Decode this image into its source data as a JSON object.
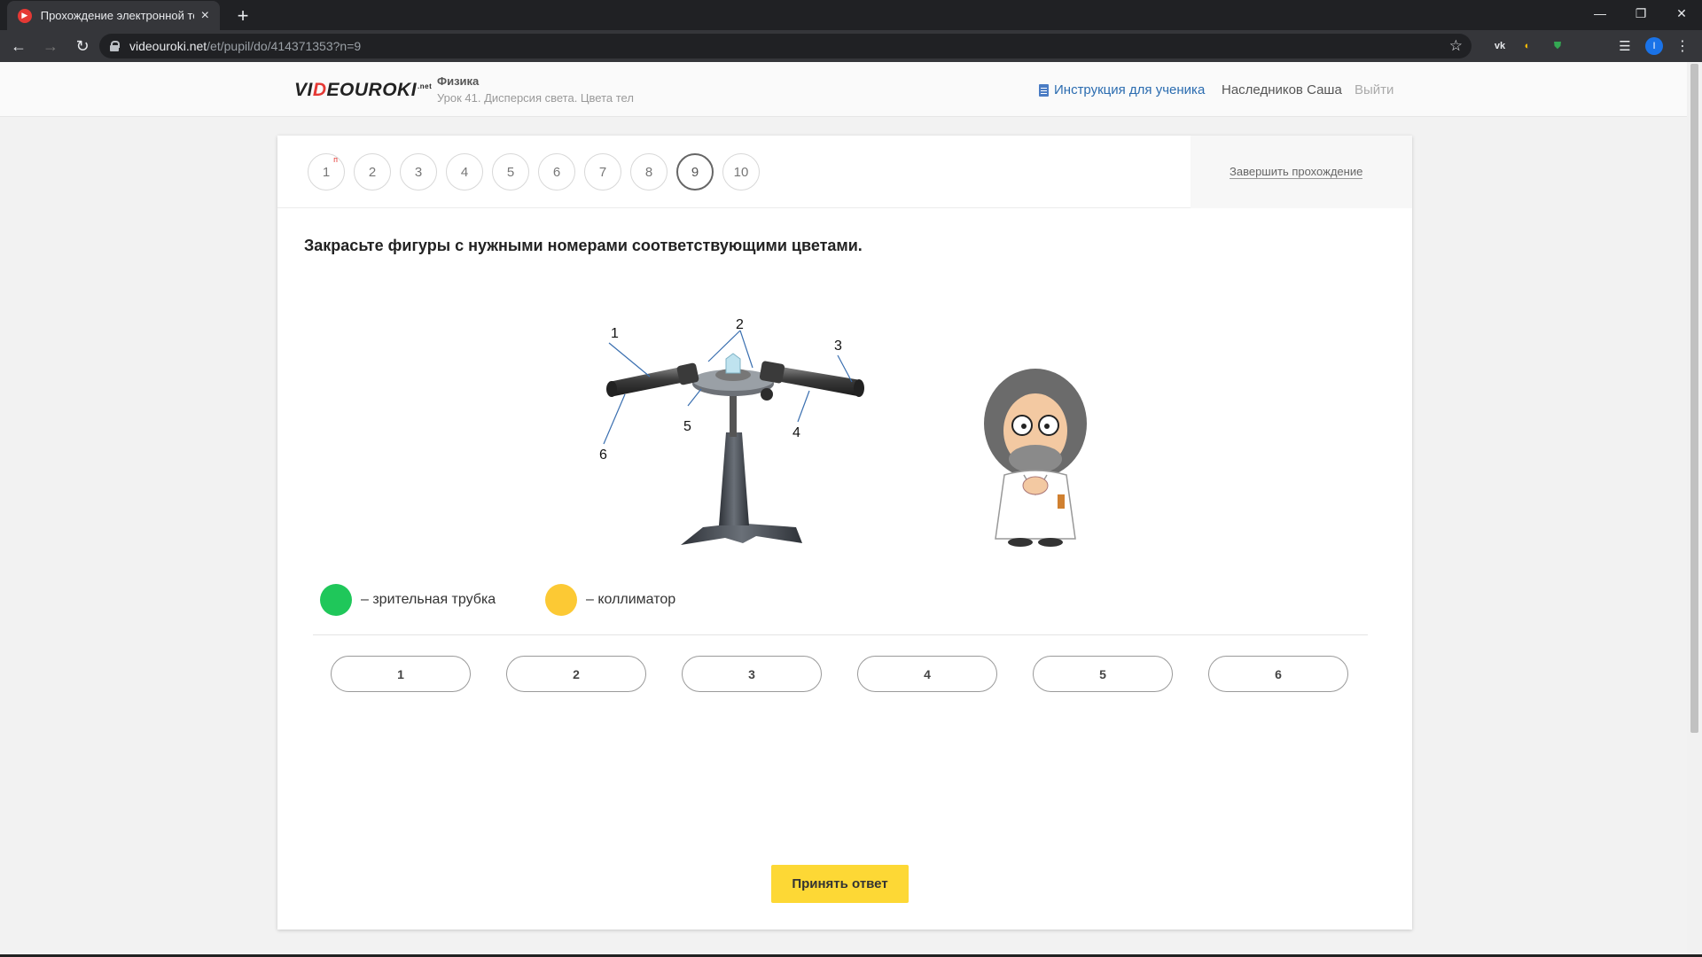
{
  "browser": {
    "tab_title": "Прохождение электронной тетр",
    "url_host": "videouroki.net",
    "url_path": "/et/pupil/do/414371353?n=9",
    "avatar_letter": "I"
  },
  "header": {
    "logo_a": "VI",
    "logo_b": "D",
    "logo_c": "EOUROKI",
    "logo_sup": ".net",
    "subject": "Физика",
    "lesson": "Урок 41. Дисперсия света. Цвета тел",
    "instructions_link": "Инструкция для ученика",
    "username": "Наследников Саша",
    "logout": "Выйти"
  },
  "steps": [
    "1",
    "2",
    "3",
    "4",
    "5",
    "6",
    "7",
    "8",
    "9",
    "10"
  ],
  "step_mark": "п",
  "finish_link": "Завершить прохождение",
  "question": "Закрасьте фигуры с нужными номерами соответствующими цветами.",
  "figure_labels": [
    "1",
    "2",
    "3",
    "4",
    "5",
    "6"
  ],
  "legend": [
    {
      "label": "– зрительная трубка",
      "color": "#1fc75a"
    },
    {
      "label": "– коллиматор",
      "color": "#fcc934"
    }
  ],
  "answers": [
    "1",
    "2",
    "3",
    "4",
    "5",
    "6"
  ],
  "submit_label": "Принять ответ"
}
